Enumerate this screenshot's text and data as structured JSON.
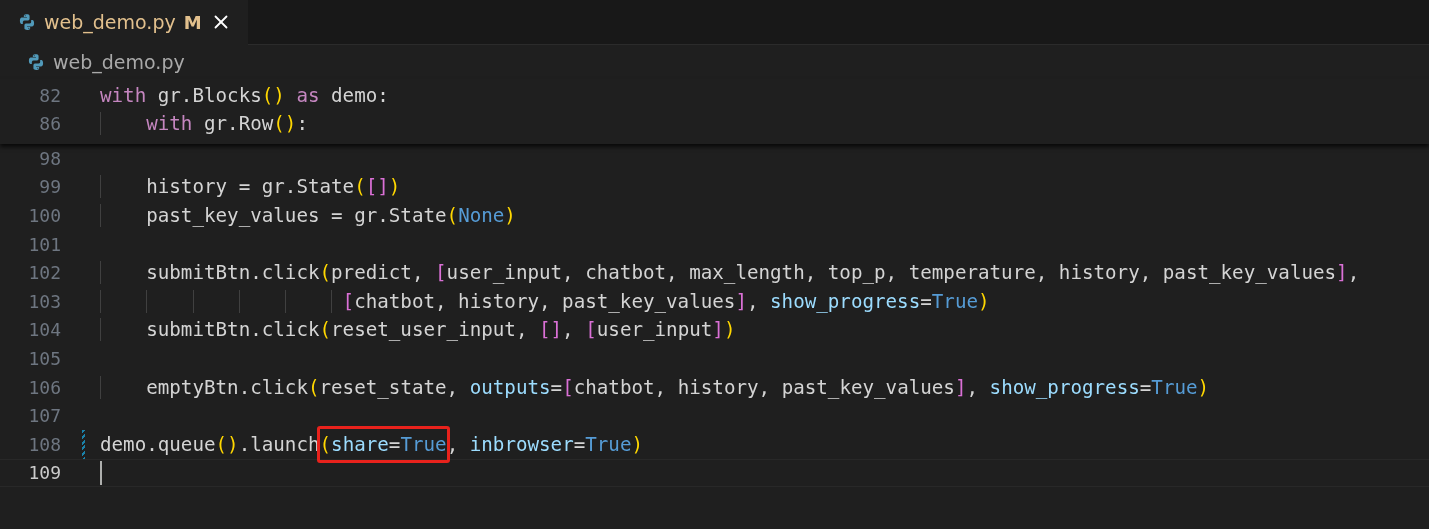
{
  "tabs": [
    {
      "label": "web_demo.py",
      "status": "M",
      "selected": true
    }
  ],
  "breadcrumb": {
    "file": "web_demo.py"
  },
  "sticky_lines": [
    {
      "number": "82",
      "tokens": [
        {
          "kind": "keyword",
          "text": "with"
        },
        {
          "kind": "plain",
          "text": " gr.Blocks"
        },
        {
          "kind": "paren",
          "text": "()"
        },
        {
          "kind": "keyword",
          "text": " as"
        },
        {
          "kind": "plain",
          "text": " demo:"
        }
      ]
    },
    {
      "number": "86",
      "tokens": [
        {
          "kind": "keyword",
          "text": "    with"
        },
        {
          "kind": "plain",
          "text": " gr.Row"
        },
        {
          "kind": "paren",
          "text": "()"
        },
        {
          "kind": "plain",
          "text": ":"
        }
      ]
    }
  ],
  "lines": [
    {
      "number": "98",
      "modified": false,
      "current": false
    },
    {
      "number": "99",
      "modified": false,
      "current": false,
      "tokens": [
        {
          "kind": "plain",
          "text": "    history = gr.State"
        },
        {
          "kind": "paren",
          "text": "("
        },
        {
          "kind": "bracket",
          "text": "[]"
        },
        {
          "kind": "paren",
          "text": ")"
        }
      ]
    },
    {
      "number": "100",
      "modified": false,
      "current": false,
      "tokens": [
        {
          "kind": "plain",
          "text": "    past_key_values = gr.State"
        },
        {
          "kind": "paren",
          "text": "("
        },
        {
          "kind": "constant",
          "text": "None"
        },
        {
          "kind": "paren",
          "text": ")"
        }
      ]
    },
    {
      "number": "101",
      "modified": false,
      "current": false
    },
    {
      "number": "102",
      "modified": false,
      "current": false,
      "tokens": [
        {
          "kind": "plain",
          "text": "    submitBtn.click"
        },
        {
          "kind": "paren",
          "text": "("
        },
        {
          "kind": "plain",
          "text": "predict, "
        },
        {
          "kind": "bracket",
          "text": "["
        },
        {
          "kind": "plain",
          "text": "user_input, chatbot, max_length, top_p, temperature, history, past_key_values"
        },
        {
          "kind": "bracket",
          "text": "]"
        },
        {
          "kind": "plain",
          "text": ","
        }
      ]
    },
    {
      "number": "103",
      "modified": false,
      "current": false,
      "tokens": [
        {
          "kind": "bracket",
          "text": "                     ["
        },
        {
          "kind": "plain",
          "text": "chatbot, history, past_key_values"
        },
        {
          "kind": "bracket",
          "text": "]"
        },
        {
          "kind": "plain",
          "text": ", "
        },
        {
          "kind": "param",
          "text": "show_progress"
        },
        {
          "kind": "plain",
          "text": "="
        },
        {
          "kind": "constant",
          "text": "True"
        },
        {
          "kind": "paren",
          "text": ")"
        }
      ]
    },
    {
      "number": "104",
      "modified": false,
      "current": false,
      "tokens": [
        {
          "kind": "plain",
          "text": "    submitBtn.click"
        },
        {
          "kind": "paren",
          "text": "("
        },
        {
          "kind": "plain",
          "text": "reset_user_input, "
        },
        {
          "kind": "bracket",
          "text": "[]"
        },
        {
          "kind": "plain",
          "text": ", "
        },
        {
          "kind": "bracket",
          "text": "["
        },
        {
          "kind": "plain",
          "text": "user_input"
        },
        {
          "kind": "bracket",
          "text": "]"
        },
        {
          "kind": "paren",
          "text": ")"
        }
      ]
    },
    {
      "number": "105",
      "modified": false,
      "current": false
    },
    {
      "number": "106",
      "modified": false,
      "current": false,
      "tokens": [
        {
          "kind": "plain",
          "text": "    emptyBtn.click"
        },
        {
          "kind": "paren",
          "text": "("
        },
        {
          "kind": "plain",
          "text": "reset_state, "
        },
        {
          "kind": "param",
          "text": "outputs"
        },
        {
          "kind": "plain",
          "text": "="
        },
        {
          "kind": "bracket",
          "text": "["
        },
        {
          "kind": "plain",
          "text": "chatbot, history, past_key_values"
        },
        {
          "kind": "bracket",
          "text": "]"
        },
        {
          "kind": "plain",
          "text": ", "
        },
        {
          "kind": "param",
          "text": "show_progress"
        },
        {
          "kind": "plain",
          "text": "="
        },
        {
          "kind": "constant",
          "text": "True"
        },
        {
          "kind": "paren",
          "text": ")"
        }
      ]
    },
    {
      "number": "107",
      "modified": false,
      "current": false
    },
    {
      "number": "108",
      "modified": true,
      "current": false,
      "tokens": [
        {
          "kind": "plain",
          "text": "demo.queue"
        },
        {
          "kind": "paren",
          "text": "()"
        },
        {
          "kind": "plain",
          "text": ".launch"
        },
        {
          "kind": "paren",
          "text": "(",
          "boxed": true
        },
        {
          "kind": "param",
          "text": "share",
          "boxed": true
        },
        {
          "kind": "plain",
          "text": "=",
          "boxed": true
        },
        {
          "kind": "constant",
          "text": "True",
          "boxed": true
        },
        {
          "kind": "plain",
          "text": ", "
        },
        {
          "kind": "param",
          "text": "inbrowser"
        },
        {
          "kind": "plain",
          "text": "="
        },
        {
          "kind": "constant",
          "text": "True"
        },
        {
          "kind": "paren",
          "text": ")"
        }
      ]
    },
    {
      "number": "109",
      "modified": false,
      "current": true
    }
  ]
}
